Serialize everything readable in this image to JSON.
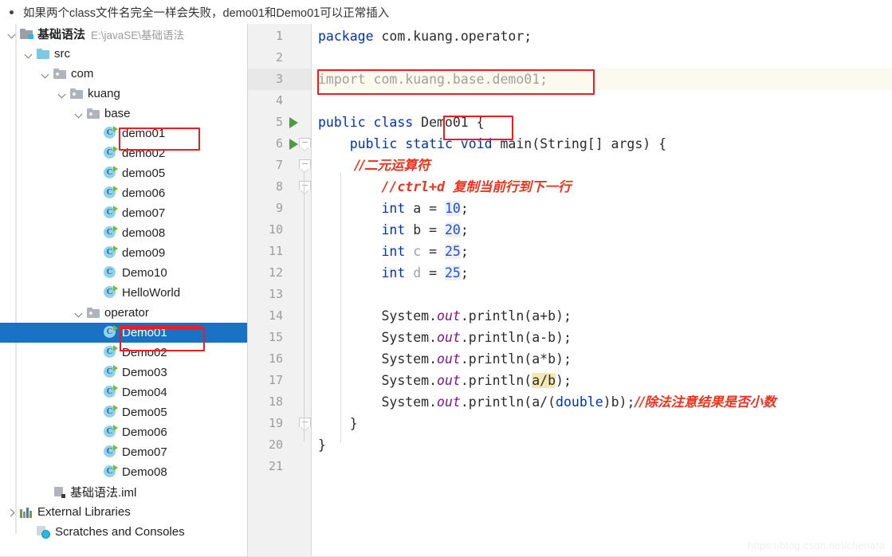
{
  "note": {
    "text": "如果两个class文件名完全一样会失败，demo01和Demo01可以正常插入"
  },
  "project_tree": {
    "items": [
      {
        "label": "基础语法",
        "sub": "E:\\javaSE\\基础语法",
        "icon": "module-folder-icon",
        "indent": 0,
        "twisty": "open",
        "bold": true
      },
      {
        "label": "src",
        "sub": "",
        "icon": "source-folder-icon",
        "indent": 1,
        "twisty": "open",
        "bold": false
      },
      {
        "label": "com",
        "sub": "",
        "icon": "package-folder-icon",
        "indent": 2,
        "twisty": "open",
        "bold": false
      },
      {
        "label": "kuang",
        "sub": "",
        "icon": "package-folder-icon",
        "indent": 3,
        "twisty": "open",
        "bold": false
      },
      {
        "label": "base",
        "sub": "",
        "icon": "package-folder-icon",
        "indent": 4,
        "twisty": "open",
        "bold": false
      },
      {
        "label": "demo01",
        "sub": "",
        "icon": "java-class-runnable-icon",
        "indent": 5,
        "twisty": "none",
        "bold": false
      },
      {
        "label": "demo02",
        "sub": "",
        "icon": "java-class-runnable-icon",
        "indent": 5,
        "twisty": "none",
        "bold": false
      },
      {
        "label": "demo05",
        "sub": "",
        "icon": "java-class-runnable-icon",
        "indent": 5,
        "twisty": "none",
        "bold": false
      },
      {
        "label": "demo06",
        "sub": "",
        "icon": "java-class-runnable-icon",
        "indent": 5,
        "twisty": "none",
        "bold": false
      },
      {
        "label": "demo07",
        "sub": "",
        "icon": "java-class-runnable-icon",
        "indent": 5,
        "twisty": "none",
        "bold": false
      },
      {
        "label": "demo08",
        "sub": "",
        "icon": "java-class-runnable-icon",
        "indent": 5,
        "twisty": "none",
        "bold": false
      },
      {
        "label": "demo09",
        "sub": "",
        "icon": "java-class-runnable-icon",
        "indent": 5,
        "twisty": "none",
        "bold": false
      },
      {
        "label": "Demo10",
        "sub": "",
        "icon": "java-class-icon",
        "indent": 5,
        "twisty": "none",
        "bold": false
      },
      {
        "label": "HelloWorld",
        "sub": "",
        "icon": "java-class-runnable-icon",
        "indent": 5,
        "twisty": "none",
        "bold": false
      },
      {
        "label": "operator",
        "sub": "",
        "icon": "package-folder-icon",
        "indent": 4,
        "twisty": "open",
        "bold": false
      },
      {
        "label": "Demo01",
        "sub": "",
        "icon": "java-class-runnable-icon",
        "indent": 5,
        "twisty": "none",
        "bold": false,
        "selected": true
      },
      {
        "label": "Demo02",
        "sub": "",
        "icon": "java-class-runnable-icon",
        "indent": 5,
        "twisty": "none",
        "bold": false
      },
      {
        "label": "Demo03",
        "sub": "",
        "icon": "java-class-runnable-icon",
        "indent": 5,
        "twisty": "none",
        "bold": false
      },
      {
        "label": "Demo04",
        "sub": "",
        "icon": "java-class-runnable-icon",
        "indent": 5,
        "twisty": "none",
        "bold": false
      },
      {
        "label": "Demo05",
        "sub": "",
        "icon": "java-class-runnable-icon",
        "indent": 5,
        "twisty": "none",
        "bold": false
      },
      {
        "label": "Demo06",
        "sub": "",
        "icon": "java-class-runnable-icon",
        "indent": 5,
        "twisty": "none",
        "bold": false
      },
      {
        "label": "Demo07",
        "sub": "",
        "icon": "java-class-runnable-icon",
        "indent": 5,
        "twisty": "none",
        "bold": false
      },
      {
        "label": "Demo08",
        "sub": "",
        "icon": "java-class-runnable-icon",
        "indent": 5,
        "twisty": "none",
        "bold": false
      },
      {
        "label": "基础语法.iml",
        "sub": "",
        "icon": "iml-file-icon",
        "indent": 2,
        "twisty": "none",
        "bold": false
      },
      {
        "label": "External Libraries",
        "sub": "",
        "icon": "libraries-icon",
        "indent": 0,
        "twisty": "closed",
        "bold": false
      },
      {
        "label": "Scratches and Consoles",
        "sub": "",
        "icon": "scratches-icon",
        "indent": 1,
        "twisty": "none",
        "bold": false
      }
    ]
  },
  "editor": {
    "line_numbers": [
      "1",
      "2",
      "3",
      "4",
      "5",
      "6",
      "7",
      "8",
      "9",
      "10",
      "11",
      "12",
      "13",
      "14",
      "15",
      "16",
      "17",
      "18",
      "19",
      "20",
      "21"
    ],
    "current_line": 3,
    "lines": [
      {
        "n": 1,
        "tokens": [
          {
            "t": "package ",
            "c": "kw"
          },
          {
            "t": "com.kuang.operator;",
            "c": "plain"
          }
        ]
      },
      {
        "n": 2,
        "tokens": []
      },
      {
        "n": 3,
        "tokens": [
          {
            "t": "import com.kuang.base.demo01;",
            "c": "grey"
          }
        ]
      },
      {
        "n": 4,
        "tokens": []
      },
      {
        "n": 5,
        "tokens": [
          {
            "t": "public class ",
            "c": "kw"
          },
          {
            "t": "Demo01",
            "c": "plain"
          },
          {
            "t": " {",
            "c": "plain"
          }
        ]
      },
      {
        "n": 6,
        "tokens": [
          {
            "t": "    public static void ",
            "c": "kw"
          },
          {
            "t": "main(",
            "c": "plain"
          },
          {
            "t": "String[] args",
            "c": "plain"
          },
          {
            "t": ") {",
            "c": "plain"
          }
        ]
      },
      {
        "n": 7,
        "tokens": [
          {
            "t": "        //二元运算符",
            "c": "cmt-cn"
          }
        ]
      },
      {
        "n": 8,
        "tokens": [
          {
            "t": "        //ctrl+d ",
            "c": "cmt"
          },
          {
            "t": "复制当前行到下一行",
            "c": "cmt-cn"
          }
        ]
      },
      {
        "n": 9,
        "tokens": [
          {
            "t": "        int",
            "c": "kw"
          },
          {
            "t": " a = ",
            "c": "plain"
          },
          {
            "t": "10",
            "c": "num"
          },
          {
            "t": ";",
            "c": "plain"
          }
        ]
      },
      {
        "n": 10,
        "tokens": [
          {
            "t": "        int",
            "c": "kw"
          },
          {
            "t": " b = ",
            "c": "plain"
          },
          {
            "t": "20",
            "c": "num"
          },
          {
            "t": ";",
            "c": "plain"
          }
        ]
      },
      {
        "n": 11,
        "tokens": [
          {
            "t": "        int",
            "c": "kw"
          },
          {
            "t": " ",
            "c": "plain"
          },
          {
            "t": "c",
            "c": "grey"
          },
          {
            "t": " = ",
            "c": "plain"
          },
          {
            "t": "25",
            "c": "num"
          },
          {
            "t": ";",
            "c": "plain"
          }
        ]
      },
      {
        "n": 12,
        "tokens": [
          {
            "t": "        int",
            "c": "kw"
          },
          {
            "t": " ",
            "c": "plain"
          },
          {
            "t": "d",
            "c": "grey"
          },
          {
            "t": " = ",
            "c": "plain"
          },
          {
            "t": "25",
            "c": "num"
          },
          {
            "t": ";",
            "c": "plain"
          }
        ]
      },
      {
        "n": 13,
        "tokens": []
      },
      {
        "n": 14,
        "tokens": [
          {
            "t": "        System.",
            "c": "plain"
          },
          {
            "t": "out",
            "c": "fld"
          },
          {
            "t": ".println(a+b);",
            "c": "plain"
          }
        ]
      },
      {
        "n": 15,
        "tokens": [
          {
            "t": "        System.",
            "c": "plain"
          },
          {
            "t": "out",
            "c": "fld"
          },
          {
            "t": ".println(a-b);",
            "c": "plain"
          }
        ]
      },
      {
        "n": 16,
        "tokens": [
          {
            "t": "        System.",
            "c": "plain"
          },
          {
            "t": "out",
            "c": "fld"
          },
          {
            "t": ".println(a*b);",
            "c": "plain"
          }
        ]
      },
      {
        "n": 17,
        "tokens": [
          {
            "t": "        System.",
            "c": "plain"
          },
          {
            "t": "out",
            "c": "fld"
          },
          {
            "t": ".println(",
            "c": "plain"
          },
          {
            "t": "a/b",
            "c": "sel"
          },
          {
            "t": ");",
            "c": "plain"
          }
        ]
      },
      {
        "n": 18,
        "tokens": [
          {
            "t": "        System.",
            "c": "plain"
          },
          {
            "t": "out",
            "c": "fld"
          },
          {
            "t": ".println(a/(",
            "c": "plain"
          },
          {
            "t": "double",
            "c": "kw"
          },
          {
            "t": ")b);",
            "c": "plain"
          },
          {
            "t": "//除法注意结果是否小数",
            "c": "cmt-cn"
          }
        ]
      },
      {
        "n": 19,
        "tokens": [
          {
            "t": "    }",
            "c": "plain"
          }
        ]
      },
      {
        "n": 20,
        "tokens": [
          {
            "t": "}",
            "c": "plain"
          }
        ]
      },
      {
        "n": 21,
        "tokens": []
      }
    ],
    "run_arrow_lines": [
      5,
      6
    ],
    "fold_lines": [
      6,
      7,
      8,
      19
    ]
  },
  "annotations": {
    "color": "#ee1d24",
    "boxes": [
      "demo01-file-highlight",
      "Demo01-file-highlight",
      "import-statement-highlight",
      "class-name-highlight",
      "operator-folder-underline"
    ]
  },
  "watermark": {
    "text": "https://blog.csdn.net/chenafa"
  }
}
